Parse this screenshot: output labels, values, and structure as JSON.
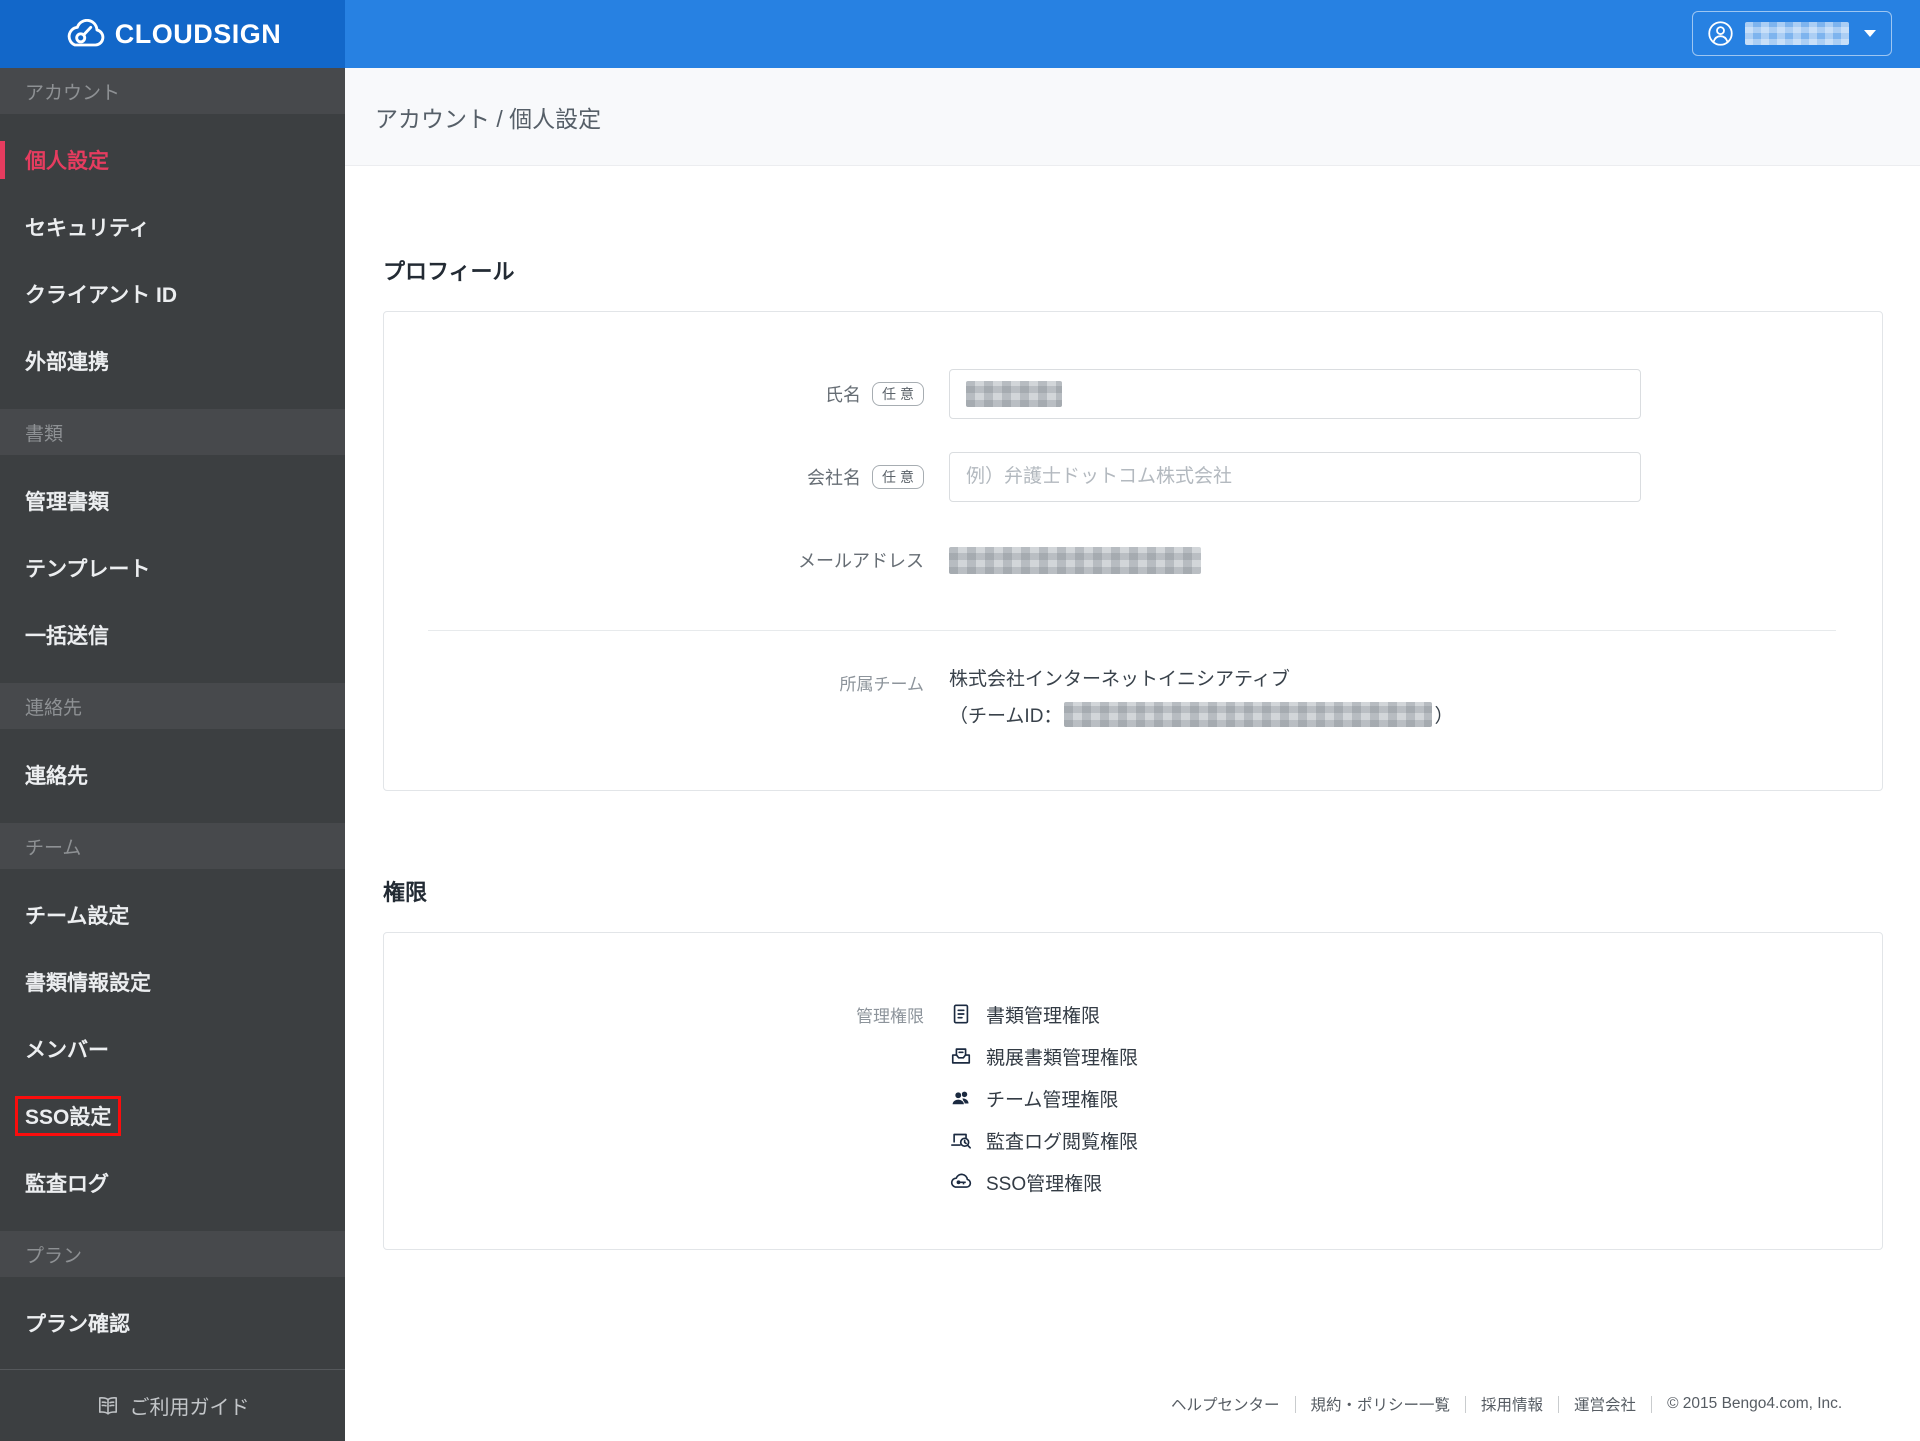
{
  "colors": {
    "header_blue": "#2781e2",
    "logo_blue": "#1267c9",
    "sidebar_bg": "#3c3f41",
    "accent_pink": "#e63c5f",
    "annotation_red": "#fb0d0d"
  },
  "logo": {
    "text": "CLOUDSIGN"
  },
  "sidebar": {
    "sections": [
      {
        "label": "アカウント",
        "items": [
          {
            "label": "個人設定",
            "active": true
          },
          {
            "label": "セキュリティ",
            "active": false
          },
          {
            "label": "クライアント ID",
            "active": false
          },
          {
            "label": "外部連携",
            "active": false
          }
        ]
      },
      {
        "label": "書類",
        "items": [
          {
            "label": "管理書類",
            "active": false
          },
          {
            "label": "テンプレート",
            "active": false
          },
          {
            "label": "一括送信",
            "active": false
          }
        ]
      },
      {
        "label": "連絡先",
        "items": [
          {
            "label": "連絡先",
            "active": false
          }
        ]
      },
      {
        "label": "チーム",
        "items": [
          {
            "label": "チーム設定",
            "active": false
          },
          {
            "label": "書類情報設定",
            "active": false
          },
          {
            "label": "メンバー",
            "active": false
          },
          {
            "label": "SSO設定",
            "active": false,
            "annotated": true
          },
          {
            "label": "監査ログ",
            "active": false
          }
        ]
      },
      {
        "label": "プラン",
        "items": [
          {
            "label": "プラン確認",
            "active": false
          }
        ]
      }
    ],
    "guide_label": "ご利用ガイド"
  },
  "breadcrumb": "アカウント / 個人設定",
  "profile": {
    "title": "プロフィール",
    "fields": {
      "name": {
        "label": "氏名",
        "badge": "任意",
        "value_blurred": true
      },
      "company": {
        "label": "会社名",
        "badge": "任意",
        "placeholder": "例）弁護士ドットコム株式会社"
      },
      "email": {
        "label": "メールアドレス",
        "value_blurred": true
      },
      "team": {
        "label": "所属チーム",
        "value": "株式会社インターネットイニシアティブ",
        "team_id_prefix": "（チームID：",
        "team_id_suffix": "）",
        "team_id_blurred": true
      }
    }
  },
  "permissions": {
    "title": "権限",
    "row_label": "管理権限",
    "items": [
      {
        "label": "書類管理権限",
        "icon": "document-icon"
      },
      {
        "label": "親展書類管理権限",
        "icon": "confidential-document-icon"
      },
      {
        "label": "チーム管理権限",
        "icon": "team-icon"
      },
      {
        "label": "監査ログ閲覧権限",
        "icon": "audit-log-icon"
      },
      {
        "label": "SSO管理権限",
        "icon": "sso-key-icon"
      }
    ]
  },
  "footer": {
    "links": [
      "ヘルプセンター",
      "規約・ポリシー一覧",
      "採用情報",
      "運営会社"
    ],
    "copyright": "© 2015 Bengo4.com, Inc."
  }
}
